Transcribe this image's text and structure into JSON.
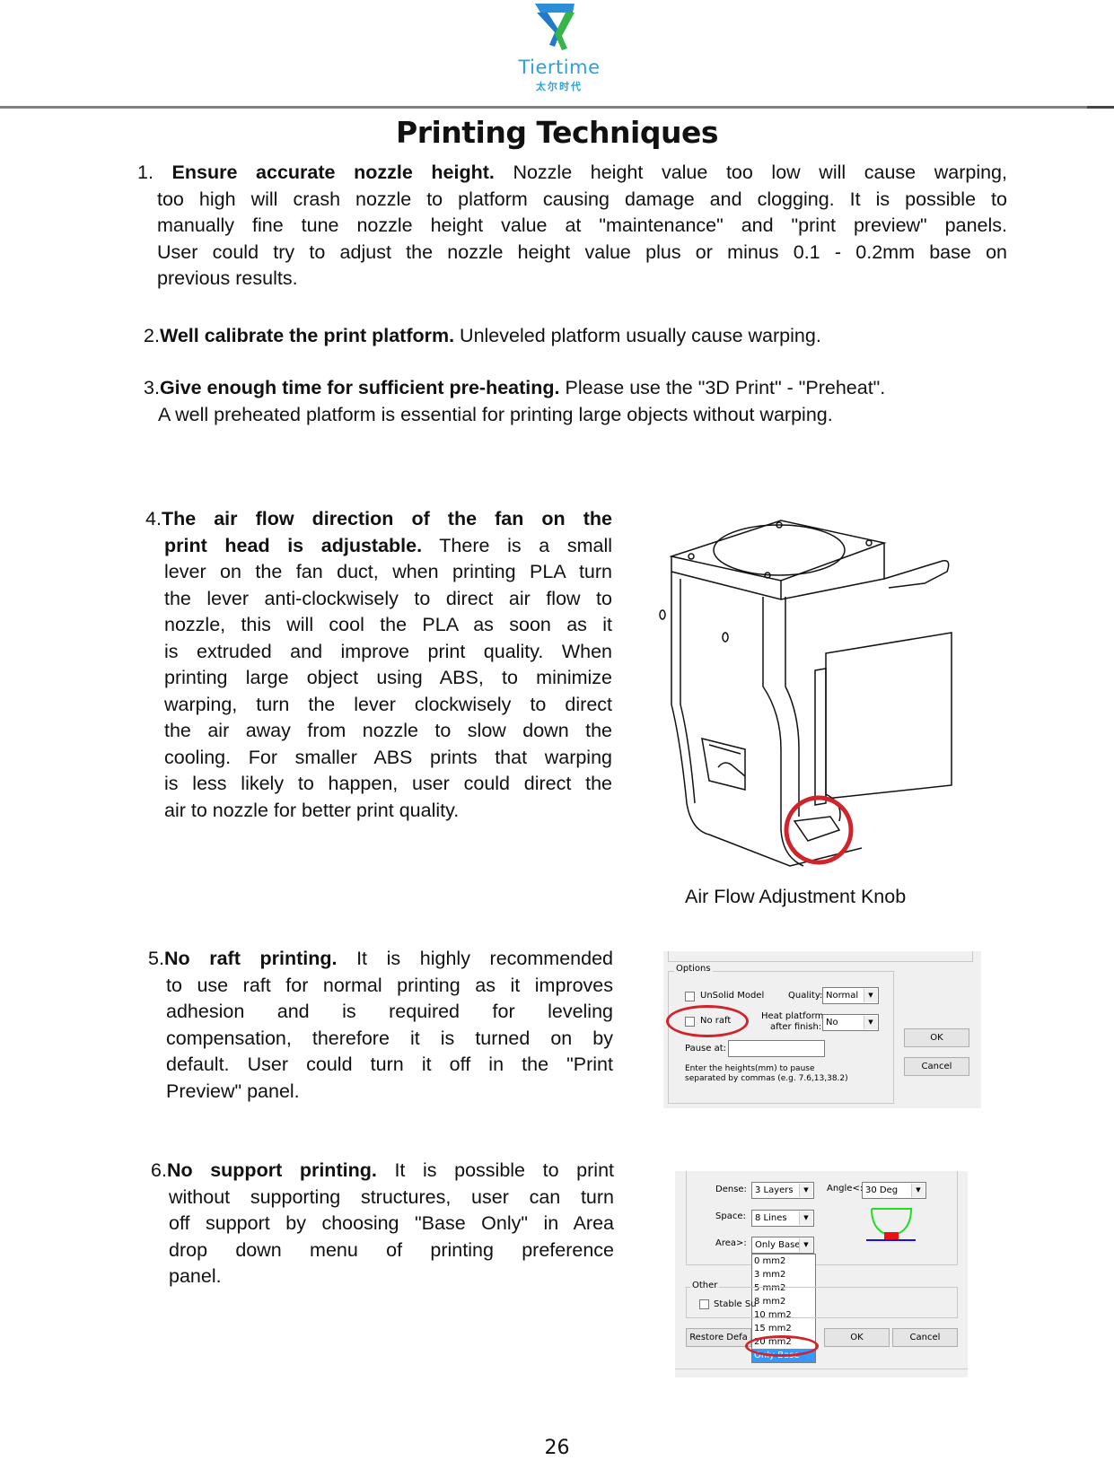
{
  "header": {
    "brand": "Tiertime",
    "brand_cn": "太尔时代",
    "brand_color": "#2aa3dc"
  },
  "page_title": "Printing Techniques",
  "tips": [
    {
      "number": "1.",
      "title": "Ensure accurate nozzle height.",
      "lines": [
        " Nozzle height value too low will cause warping,",
        "too high will crash nozzle to platform causing damage and clogging. It is possible to",
        "manually fine tune nozzle height value at \"maintenance\" and \"print preview\" panels.",
        "User could try to adjust the nozzle height value plus or minus  0.1 - 0.2mm base on",
        "previous results."
      ]
    },
    {
      "number": "2.",
      "title": "Well calibrate the print platform.",
      "lines": [
        " Unleveled platform usually cause warping."
      ]
    },
    {
      "number": "3.",
      "title": "Give enough time for sufficient pre-heating.",
      "lines": [
        " Please use the \"3D Print\" - \"Preheat\".",
        "A well preheated platform is essential for printing large objects without warping."
      ]
    },
    {
      "number": "4.",
      "title_lines": [
        "The air flow direction of the fan on the",
        "print head is adjustable."
      ],
      "lines": [
        " There is a small",
        "lever on the fan duct, when printing PLA turn",
        "the lever anti-clockwisely to direct air flow to",
        "nozzle, this will cool the PLA as soon as it",
        "is extruded and improve print quality. When",
        "printing large object using ABS, to minimize",
        "warping, turn the lever clockwisely to direct",
        "the air away from nozzle to slow down the",
        "cooling. For smaller ABS prints that warping",
        "is less likely to happen, user could direct the",
        "air to nozzle for better print quality."
      ],
      "figure_caption": "Air Flow Adjustment Knob"
    },
    {
      "number": "5.",
      "title": "No raft printing.",
      "lines": [
        " It is highly recommended",
        "to use raft for normal printing as it improves",
        "adhesion and is required for leveling",
        "compensation, therefore it is turned on by",
        "default. User could turn it off in the \"Print",
        "Preview\" panel."
      ]
    },
    {
      "number": "6.",
      "title": "No support printing.",
      "lines": [
        " It is possible to print",
        "without supporting structures, user can turn",
        "off support by choosing \"Base Only\" in Area",
        "drop down menu of printing preference",
        "panel."
      ]
    }
  ],
  "dialog_options": {
    "group_label": "Options",
    "unsolid_label": "UnSolid Model",
    "noraft_label": "No raft",
    "quality_label": "Quality:",
    "quality_value": "Normal",
    "heat_label_1": "Heat platform",
    "heat_label_2": "after finish:",
    "heat_value": "No",
    "pause_label": "Pause at:",
    "hint_1": "Enter the heights(mm) to pause",
    "hint_2": "separated by commas (e.g. 7.6,13,38.2)",
    "ok_label": "OK",
    "cancel_label": "Cancel",
    "highlight_color": "#d0232a"
  },
  "dialog_support": {
    "dense_label": "Dense:",
    "dense_value": "3 Layers",
    "angle_label": "Angle<:",
    "angle_value": "30 Deg",
    "space_label": "Space:",
    "space_value": "8 Lines",
    "area_label": "Area>:",
    "area_value": "Only Base",
    "area_options": [
      "0 mm2",
      "3 mm2",
      "5 mm2",
      "8 mm2",
      "10 mm2",
      "15 mm2",
      "20 mm2",
      "Only Base"
    ],
    "other_label": "Other",
    "stable_label": "Stable Su",
    "restore_label": "Restore Defa",
    "ok_label": "OK",
    "cancel_label": "Cancel"
  },
  "page_number": "26"
}
